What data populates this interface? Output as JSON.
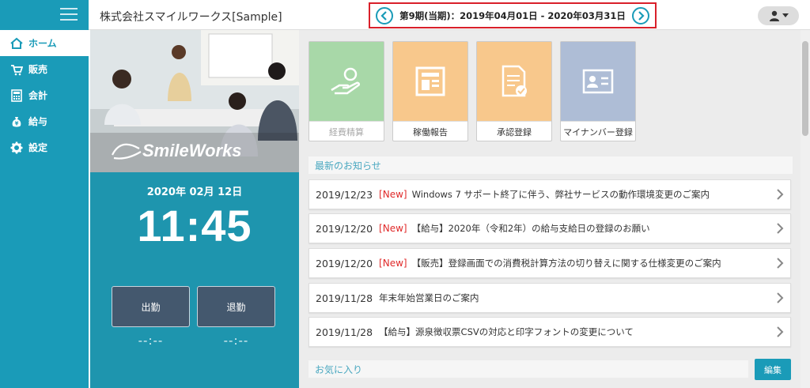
{
  "header": {
    "company": "株式会社スマイルワークス[Sample]",
    "period": "第9期(当期)：2019年04月01日 - 2020年03月31日"
  },
  "sidebar": {
    "items": [
      {
        "label": "ホーム",
        "icon": "home-icon"
      },
      {
        "label": "販売",
        "icon": "cart-icon"
      },
      {
        "label": "会計",
        "icon": "calculator-icon"
      },
      {
        "label": "給与",
        "icon": "money-bag-icon"
      },
      {
        "label": "設定",
        "icon": "gear-icon"
      }
    ]
  },
  "brand": {
    "logo_text": "SmileWorks"
  },
  "timeclock": {
    "date": "2020年 02月 12日",
    "time": "11:45",
    "clock_in_label": "出勤",
    "clock_out_label": "退勤",
    "clock_in_time": "--:--",
    "clock_out_time": "--:--"
  },
  "tiles": [
    {
      "label": "経費精算",
      "color": "#a8d8a8",
      "disabled": true,
      "icon": "hand-coin-icon"
    },
    {
      "label": "稼働報告",
      "color": "#f8c88c",
      "disabled": false,
      "icon": "report-icon"
    },
    {
      "label": "承認登録",
      "color": "#f8c88c",
      "disabled": false,
      "icon": "approval-doc-icon"
    },
    {
      "label": "マイナンバー登録",
      "color": "#aebdd6",
      "disabled": false,
      "icon": "id-card-icon"
    }
  ],
  "news": {
    "title": "最新のお知らせ",
    "items": [
      {
        "date": "2019/12/23",
        "new": "[New]",
        "text": "Windows 7 サポート終了に伴う、弊社サービスの動作環境変更のご案内"
      },
      {
        "date": "2019/12/20",
        "new": "[New]",
        "text": "【給与】2020年（令和2年）の給与支給日の登録のお願い"
      },
      {
        "date": "2019/12/20",
        "new": "[New]",
        "text": "【販売】登録画面での消費税計算方法の切り替えに関する仕様変更のご案内"
      },
      {
        "date": "2019/11/28",
        "new": "",
        "text": "年末年始営業日のご案内"
      },
      {
        "date": "2019/11/28",
        "new": "",
        "text": "【給与】源泉徴収票CSVの対応と印字フォントの変更について"
      }
    ]
  },
  "favorites": {
    "title": "お気に入り",
    "edit_label": "編集"
  }
}
